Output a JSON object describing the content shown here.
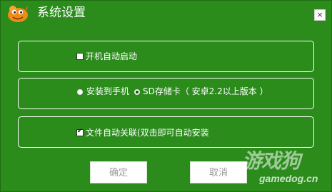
{
  "window": {
    "title": "系统设置",
    "close_glyph": "×",
    "logo_icon": "cartoon-mascot-icon"
  },
  "options": {
    "autostart": {
      "label": "开机自动启动",
      "checked": false
    },
    "install_location": {
      "phone_label": "安装到手机",
      "sd_label": "SD存储卡（ 安卓2.2以上版本 ）",
      "selected": "sd"
    },
    "file_association": {
      "label": "文件自动关联(双击即可自动安装",
      "checked": true
    }
  },
  "buttons": {
    "ok": "确定",
    "cancel": "取消"
  },
  "watermark": {
    "main": "游戏狗",
    "sub": "gamedog.cn"
  },
  "colors": {
    "background": "#2b8c1c",
    "text": "#ffffff"
  }
}
